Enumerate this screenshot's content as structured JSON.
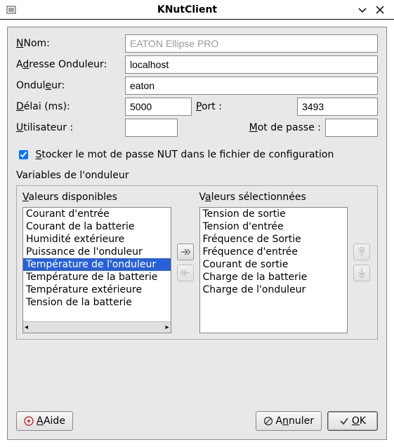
{
  "window": {
    "title": "KNutClient"
  },
  "form": {
    "nom_label": "Nom:",
    "nom_value": "EATON Ellipse PRO",
    "adresse_label": "Adresse Onduleur:",
    "adresse_value": "localhost",
    "onduleur_label": "Onduleur:",
    "onduleur_value": "eaton",
    "delai_label": "Délai (ms):",
    "delai_value": "5000",
    "port_label": "Port :",
    "port_value": "3493",
    "user_label": "Utilisateur :",
    "user_value": "",
    "pass_label": "Mot de passe :",
    "pass_value": ""
  },
  "checkbox": {
    "label": "Stocker le mot de passe NUT dans le fichier de configuration",
    "checked": true
  },
  "variables": {
    "section_title": "Variables de l'onduleur",
    "available_header": "Valeurs disponibles",
    "selected_header": "Valeurs sélectionnées",
    "available": [
      {
        "label": "Courant d'entrée",
        "selected": false
      },
      {
        "label": "Courant de la batterie",
        "selected": false
      },
      {
        "label": "Humidité extérieure",
        "selected": false
      },
      {
        "label": "Puissance de l'onduleur",
        "selected": false
      },
      {
        "label": "Température de l'onduleur",
        "selected": true
      },
      {
        "label": "Température de la batterie",
        "selected": false
      },
      {
        "label": "Température extérieure",
        "selected": false
      },
      {
        "label": "Tension de la batterie",
        "selected": false
      }
    ],
    "selected": [
      "Tension de sortie",
      "Tension d'entrée",
      "Fréquence de Sortie",
      "Fréquence d'entrée",
      "Courant de sortie",
      "Charge de la batterie",
      "Charge de l'onduleur"
    ]
  },
  "buttons": {
    "help": "Aide",
    "cancel": "Annuler",
    "ok": "OK"
  }
}
